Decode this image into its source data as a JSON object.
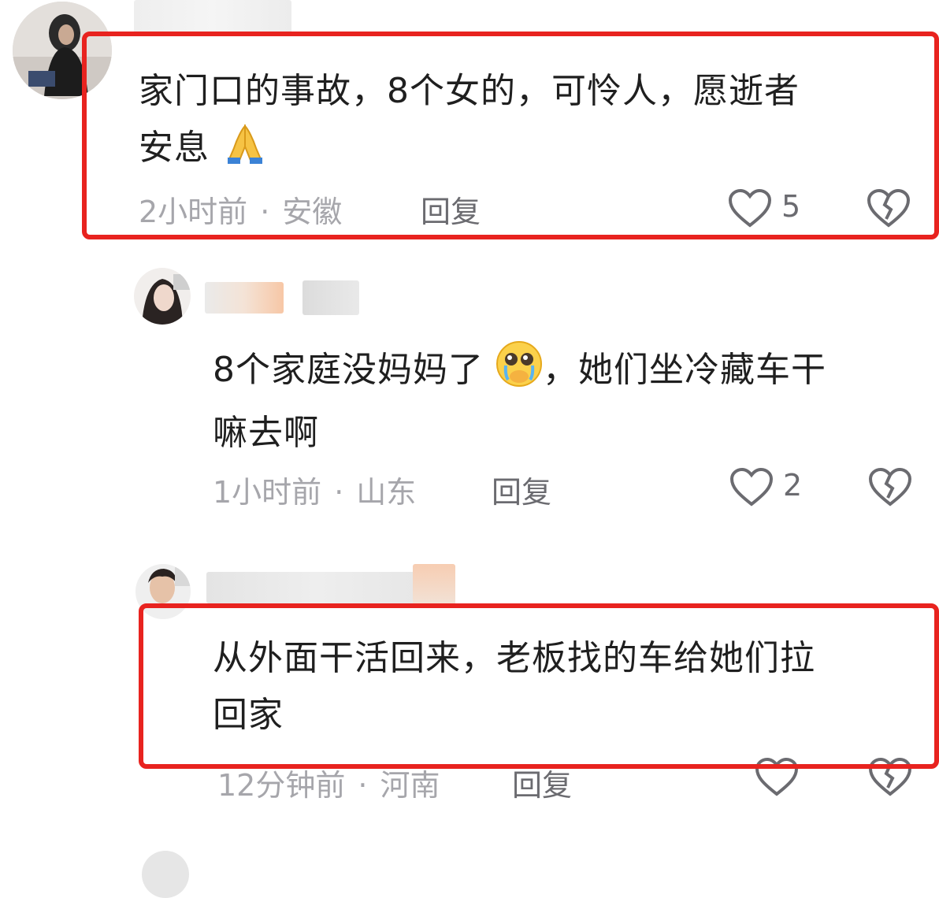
{
  "comments": [
    {
      "text_line1": "家门口的事故，8个女的，可怜人，愿逝者",
      "text_line2": "安息",
      "emoji": "pray",
      "time": "2小时前",
      "location": "安徽",
      "reply_label": "回复",
      "likes": "5",
      "highlighted": true
    },
    {
      "text_line1": "8个家庭没妈妈了",
      "emoji": "crying-face",
      "text_line1_rest": "，她们坐冷藏车干",
      "text_line2": "嘛去啊",
      "time": "1小时前",
      "location": "山东",
      "reply_label": "回复",
      "likes": "2",
      "highlighted": false
    },
    {
      "text_line1": "从外面干活回来，老板找的车给她们拉",
      "text_line2": "回家",
      "time": "12分钟前",
      "location": "河南",
      "reply_label": "回复",
      "likes": "",
      "highlighted": true
    }
  ],
  "colors": {
    "highlight": "#e8231f",
    "meta": "#a6a6ab",
    "text": "#1f1f1f"
  },
  "icons": [
    "heart-outline-icon",
    "broken-heart-icon",
    "pray-emoji",
    "crying-face-emoji"
  ]
}
